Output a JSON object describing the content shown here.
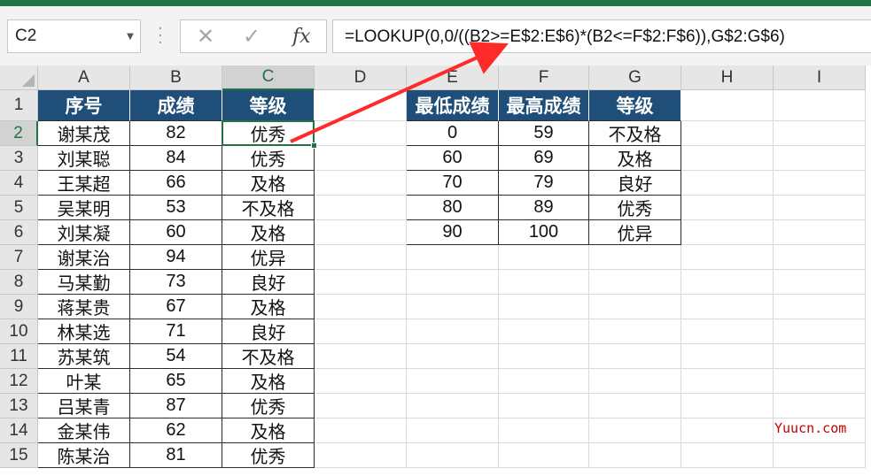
{
  "name_box": {
    "value": "C2"
  },
  "formula_bar": {
    "cancel_glyph": "✕",
    "enter_glyph": "✓",
    "fx_label": "fx",
    "formula": "=LOOKUP(0,0/((B2>=E$2:E$6)*(B2<=F$2:F$6)),G$2:G$6)"
  },
  "columns": [
    "A",
    "B",
    "C",
    "D",
    "E",
    "F",
    "G",
    "H",
    "I"
  ],
  "selected_column": "C",
  "rows": [
    "1",
    "2",
    "3",
    "4",
    "5",
    "6",
    "7",
    "8",
    "9",
    "10",
    "11",
    "12",
    "13",
    "14",
    "15"
  ],
  "selected_row": "2",
  "left_table": {
    "headers": [
      "序号",
      "成绩",
      "等级"
    ],
    "rows": [
      [
        "谢某茂",
        "82",
        "优秀"
      ],
      [
        "刘某聪",
        "84",
        "优秀"
      ],
      [
        "王某超",
        "66",
        "及格"
      ],
      [
        "吴某明",
        "53",
        "不及格"
      ],
      [
        "刘某凝",
        "60",
        "及格"
      ],
      [
        "谢某治",
        "94",
        "优异"
      ],
      [
        "马某勤",
        "73",
        "良好"
      ],
      [
        "蒋某贵",
        "67",
        "及格"
      ],
      [
        "林某选",
        "71",
        "良好"
      ],
      [
        "苏某筑",
        "54",
        "不及格"
      ],
      [
        "叶某",
        "65",
        "及格"
      ],
      [
        "吕某青",
        "87",
        "优秀"
      ],
      [
        "金某伟",
        "62",
        "及格"
      ],
      [
        "陈某治",
        "81",
        "优秀"
      ]
    ]
  },
  "right_table": {
    "headers": [
      "最低成绩",
      "最高成绩",
      "等级"
    ],
    "rows": [
      [
        "0",
        "59",
        "不及格"
      ],
      [
        "60",
        "69",
        "及格"
      ],
      [
        "70",
        "79",
        "良好"
      ],
      [
        "80",
        "89",
        "优秀"
      ],
      [
        "90",
        "100",
        "优异"
      ]
    ]
  },
  "watermark": "Yuucn.com",
  "colors": {
    "excel_green": "#217346",
    "header_fill": "#1f4e79",
    "arrow_red": "#ff2a2a",
    "watermark": "#c00000"
  }
}
